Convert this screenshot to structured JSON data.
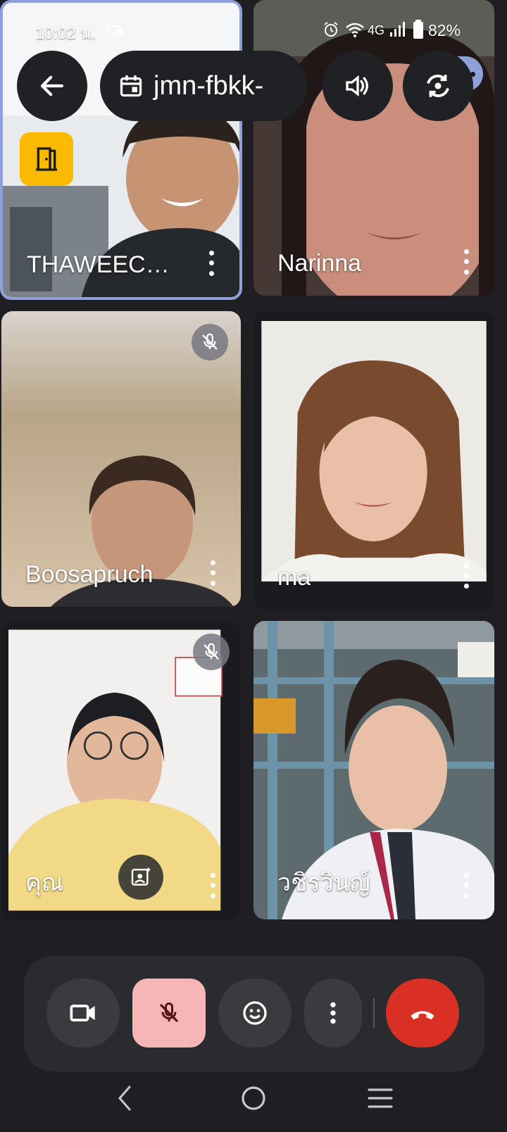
{
  "status_bar": {
    "time": "10:02 น.",
    "network": "4G",
    "battery": "82%"
  },
  "top_bar": {
    "meeting_code": "jmn-fbkk-",
    "back_icon": "arrow-back-icon",
    "calendar_icon": "calendar-icon",
    "audio_icon": "volume-icon",
    "switch_camera_icon": "switch-camera-icon",
    "exit_icon": "door-exit-icon"
  },
  "participants": [
    {
      "name": "THAWEEC…",
      "muted": false
    },
    {
      "name": "Narinna",
      "muted": false
    },
    {
      "name": "Boosapruch",
      "muted": true
    },
    {
      "name": "ma",
      "muted": false
    },
    {
      "name": "คุณ",
      "muted": true
    },
    {
      "name": "วชิรวินญ์",
      "muted": false
    }
  ],
  "controls": {
    "camera_icon": "video-camera-icon",
    "mic_icon": "mic-off-icon",
    "reactions_icon": "emoji-icon",
    "more_icon": "more-vert-icon",
    "end_call_icon": "call-end-icon"
  },
  "colors": {
    "background": "#1f1f23",
    "active_tile_border": "#8ea1d8",
    "mic_off_bg": "#f4b6b6",
    "end_call": "#d93025",
    "exit_badge": "#f9ba00"
  }
}
